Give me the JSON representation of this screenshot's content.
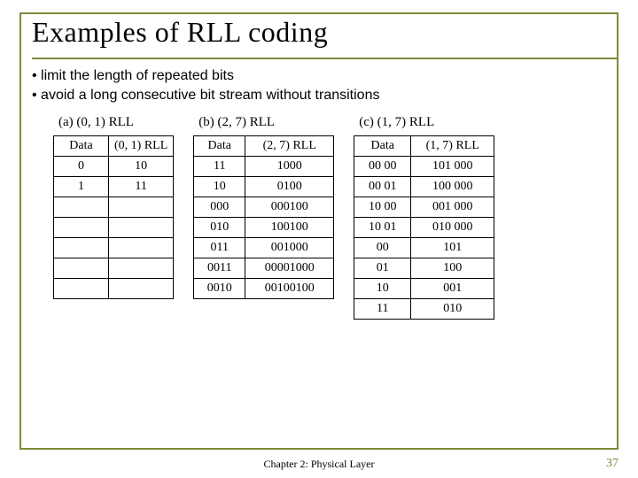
{
  "title": "Examples of RLL coding",
  "bullets": [
    "limit the length of repeated bits",
    "avoid a long consecutive bit stream without transitions"
  ],
  "tables": {
    "a": {
      "caption": "(a) (0, 1) RLL",
      "headers": [
        "Data",
        "(0, 1) RLL"
      ],
      "rows": [
        [
          "0",
          "10"
        ],
        [
          "1",
          "11"
        ],
        [
          "",
          ""
        ],
        [
          "",
          ""
        ],
        [
          "",
          ""
        ],
        [
          "",
          ""
        ],
        [
          "",
          ""
        ]
      ]
    },
    "b": {
      "caption": "(b) (2, 7) RLL",
      "headers": [
        "Data",
        "(2, 7) RLL"
      ],
      "rows": [
        [
          "11",
          "1000"
        ],
        [
          "10",
          "0100"
        ],
        [
          "000",
          "000100"
        ],
        [
          "010",
          "100100"
        ],
        [
          "011",
          "001000"
        ],
        [
          "0011",
          "00001000"
        ],
        [
          "0010",
          "00100100"
        ]
      ]
    },
    "c": {
      "caption": "(c) (1, 7) RLL",
      "headers": [
        "Data",
        "(1, 7) RLL"
      ],
      "rows": [
        [
          "00 00",
          "101 000"
        ],
        [
          "00 01",
          "100 000"
        ],
        [
          "10 00",
          "001 000"
        ],
        [
          "10 01",
          "010 000"
        ],
        [
          "00",
          "101"
        ],
        [
          "01",
          "100"
        ],
        [
          "10",
          "001"
        ],
        [
          "11",
          "010"
        ]
      ]
    }
  },
  "footer": "Chapter 2: Physical Layer",
  "page": "37"
}
